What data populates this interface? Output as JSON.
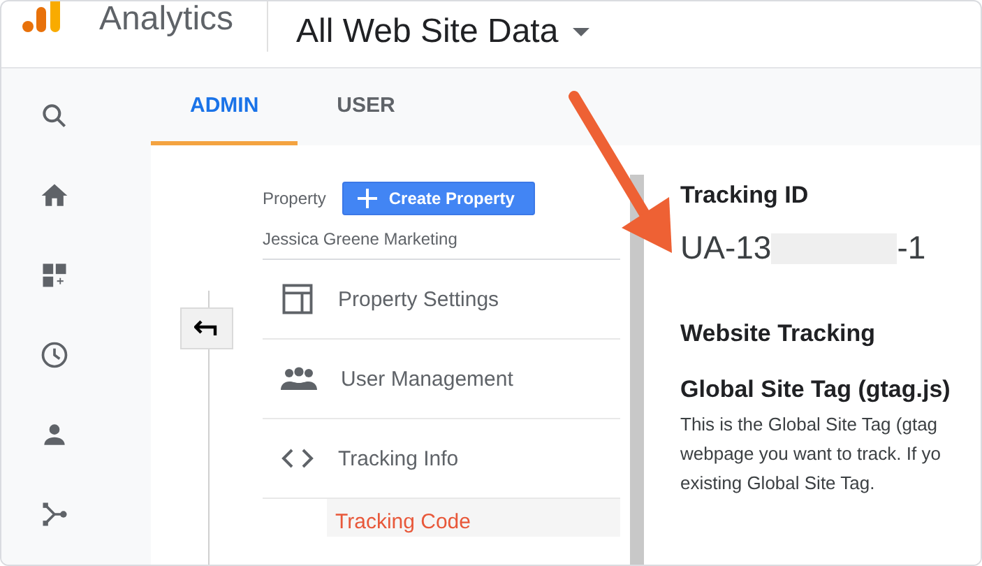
{
  "header": {
    "product": "Analytics",
    "view": "All Web Site Data"
  },
  "rail": [
    {
      "kind": "search"
    },
    {
      "kind": "home"
    },
    {
      "kind": "dashboard"
    },
    {
      "kind": "clock"
    },
    {
      "kind": "person"
    },
    {
      "kind": "branch"
    }
  ],
  "tabs": [
    {
      "label": "ADMIN",
      "selected": true
    },
    {
      "label": "USER",
      "selected": false
    }
  ],
  "property": {
    "label": "Property",
    "button": "Create Property",
    "name": "Jessica Greene Marketing"
  },
  "menu": [
    {
      "kind": "settings",
      "label": "Property Settings"
    },
    {
      "kind": "users",
      "label": "User Management"
    },
    {
      "kind": "code",
      "label": "Tracking Info"
    },
    {
      "kind": "sub",
      "label": "Tracking Code",
      "selected": true
    }
  ],
  "detail": {
    "id_heading": "Tracking ID",
    "id_start": "UA-13",
    "id_end": "-1",
    "section": "Website Tracking",
    "subheading": "Global Site Tag (gtag.js)",
    "body": "This is the Global Site Tag (gtag\nwebpage you want to track. If yo\nexisting Global Site Tag."
  }
}
